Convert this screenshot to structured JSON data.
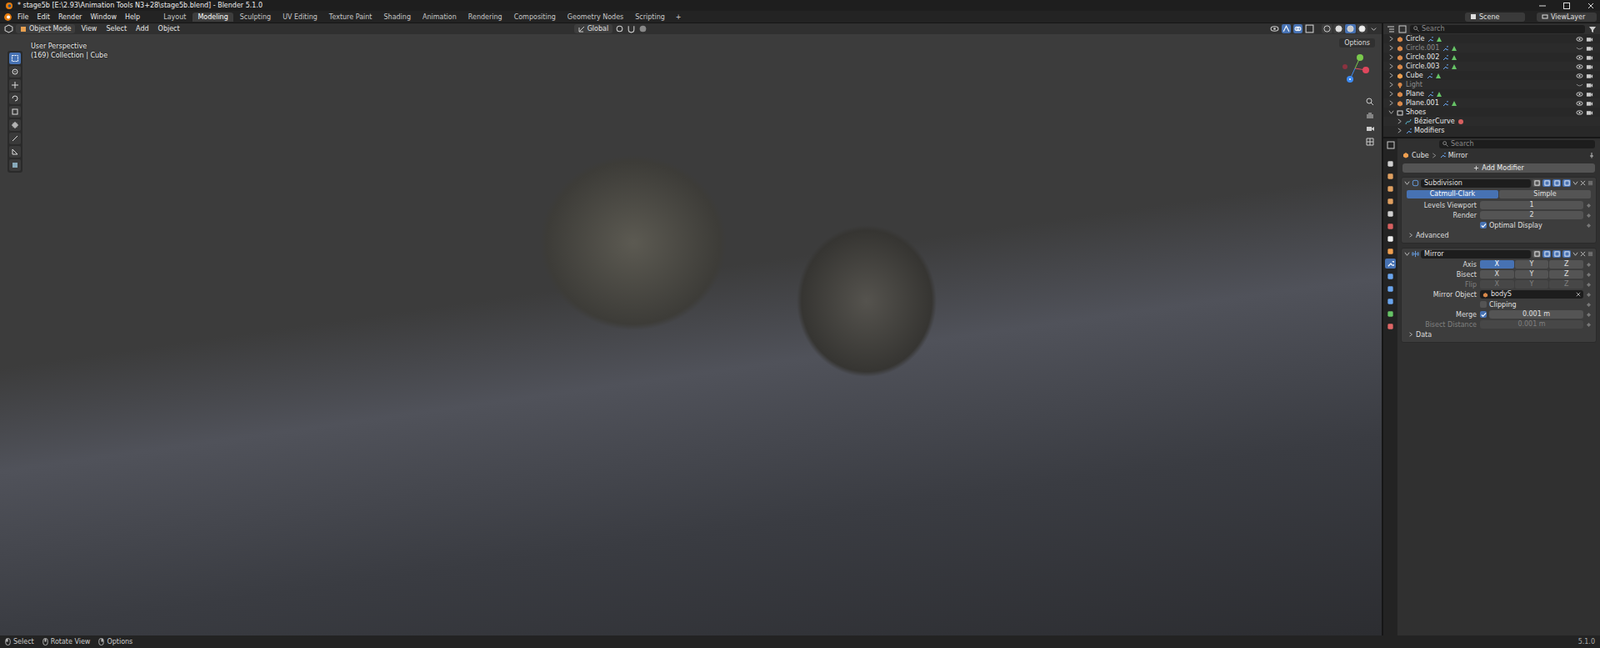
{
  "window": {
    "title": "* stage5b [E:\\2.93\\Animation Tools N3+28\\stage5b.blend] - Blender 5.1.0"
  },
  "menu": [
    "File",
    "Edit",
    "Render",
    "Window",
    "Help"
  ],
  "workspaces": [
    {
      "label": "Layout",
      "selected": false
    },
    {
      "label": "Modeling",
      "selected": true
    },
    {
      "label": "Sculpting",
      "selected": false
    },
    {
      "label": "UV Editing",
      "selected": false
    },
    {
      "label": "Texture Paint",
      "selected": false
    },
    {
      "label": "Shading",
      "selected": false
    },
    {
      "label": "Animation",
      "selected": false
    },
    {
      "label": "Rendering",
      "selected": false
    },
    {
      "label": "Compositing",
      "selected": false
    },
    {
      "label": "Geometry Nodes",
      "selected": false
    },
    {
      "label": "Scripting",
      "selected": false
    }
  ],
  "add_workspace": "+",
  "scene": "Scene",
  "view_layer": "ViewLayer",
  "viewport": {
    "mode": "Object Mode",
    "menus": [
      "View",
      "Select",
      "Add",
      "Object"
    ],
    "orientation": "Global",
    "options": "Options",
    "overlay": [
      "User Perspective",
      "(169) Collection | Cube"
    ],
    "shading": [
      {
        "selected": false
      },
      {
        "selected": false
      },
      {
        "selected": true
      },
      {
        "selected": false
      }
    ],
    "tools": [
      {
        "selected": true
      },
      {
        "selected": false
      },
      {
        "selected": false
      },
      {
        "selected": false
      },
      {
        "selected": false
      },
      {
        "selected": false
      },
      {
        "selected": false
      },
      {
        "selected": false
      },
      {
        "selected": false
      }
    ]
  },
  "outliner": {
    "search_placeholder": "Search",
    "items": [
      {
        "name": "Circle",
        "kind": "mesh",
        "hidden": false,
        "active": false,
        "expanded": false,
        "depth": 0
      },
      {
        "name": "Circle.001",
        "kind": "mesh",
        "hidden": true,
        "active": false,
        "expanded": false,
        "depth": 0
      },
      {
        "name": "Circle.002",
        "kind": "mesh",
        "hidden": false,
        "active": false,
        "expanded": false,
        "depth": 0
      },
      {
        "name": "Circle.003",
        "kind": "mesh",
        "hidden": false,
        "active": false,
        "expanded": false,
        "depth": 0
      },
      {
        "name": "Cube",
        "kind": "mesh",
        "hidden": false,
        "active": true,
        "expanded": false,
        "depth": 0
      },
      {
        "name": "Light",
        "kind": "light",
        "hidden": true,
        "active": false,
        "expanded": false,
        "depth": 0
      },
      {
        "name": "Plane",
        "kind": "mesh",
        "hidden": false,
        "active": false,
        "expanded": false,
        "depth": 0
      },
      {
        "name": "Plane.001",
        "kind": "mesh",
        "hidden": false,
        "active": false,
        "expanded": false,
        "depth": 0
      },
      {
        "name": "Shoes",
        "kind": "collection",
        "hidden": false,
        "active": false,
        "expanded": true,
        "depth": 0
      },
      {
        "name": "BézierCurve",
        "kind": "curve",
        "hidden": false,
        "active": false,
        "expanded": false,
        "depth": 1
      },
      {
        "name": "Modifiers",
        "kind": "modifiers",
        "hidden": false,
        "active": false,
        "expanded": false,
        "depth": 1
      }
    ]
  },
  "properties": {
    "breadcrumb": [
      "Cube",
      "Mirror"
    ],
    "search_placeholder": "Search",
    "add_modifier": "Add Modifier",
    "tabs": [
      {
        "selected": false
      },
      {
        "selected": false
      },
      {
        "selected": false
      },
      {
        "selected": false
      },
      {
        "selected": false
      },
      {
        "selected": false
      },
      {
        "selected": false
      },
      {
        "selected": false
      },
      {
        "selected": true
      },
      {
        "selected": false
      },
      {
        "selected": false
      },
      {
        "selected": false
      },
      {
        "selected": false
      },
      {
        "selected": false
      }
    ],
    "modifiers": [
      {
        "name": "Subdivision",
        "expanded": true,
        "toggles": [
          false,
          true,
          true,
          true
        ],
        "rows": [
          {
            "kind": "segmented",
            "label": "",
            "disabled": false,
            "options": [
              {
                "label": "Catmull-Clark",
                "selected": true
              },
              {
                "label": "Simple",
                "selected": false
              }
            ]
          },
          {
            "kind": "number",
            "label": "Levels Viewport",
            "value": "1",
            "disabled": false
          },
          {
            "kind": "number",
            "label": "Render",
            "value": "2",
            "disabled": false
          },
          {
            "kind": "checkbox",
            "label": "Optimal Display",
            "checked": true,
            "disabled": false
          },
          {
            "kind": "subpanel",
            "label": "Advanced",
            "expanded": false,
            "disabled": false
          }
        ]
      },
      {
        "name": "Mirror",
        "expanded": true,
        "toggles": [
          false,
          true,
          true,
          true
        ],
        "rows": [
          {
            "kind": "toggles",
            "label": "Axis",
            "disabled": false,
            "options": [
              {
                "label": "X",
                "selected": true
              },
              {
                "label": "Y",
                "selected": false
              },
              {
                "label": "Z",
                "selected": false
              }
            ]
          },
          {
            "kind": "toggles",
            "label": "Bisect",
            "disabled": false,
            "options": [
              {
                "label": "X",
                "selected": false
              },
              {
                "label": "Y",
                "selected": false
              },
              {
                "label": "Z",
                "selected": false
              }
            ]
          },
          {
            "kind": "toggles",
            "label": "Flip",
            "disabled": true,
            "options": [
              {
                "label": "X",
                "selected": false
              },
              {
                "label": "Y",
                "selected": false
              },
              {
                "label": "Z",
                "selected": false
              }
            ]
          },
          {
            "kind": "object",
            "label": "Mirror Object",
            "value": "bodyS",
            "disabled": false
          },
          {
            "kind": "checkbox",
            "label": "Clipping",
            "checked": false,
            "disabled": false
          },
          {
            "kind": "checknumber",
            "label": "Merge",
            "checked": true,
            "value": "0.001 m",
            "disabled": false
          },
          {
            "kind": "number",
            "label": "Bisect Distance",
            "value": "0.001 m",
            "disabled": true
          },
          {
            "kind": "subpanel",
            "label": "Data",
            "expanded": false,
            "disabled": false
          }
        ]
      }
    ]
  },
  "status_bar": {
    "items": [
      "Select",
      "Rotate View",
      "Options"
    ],
    "version": "5.1.0"
  }
}
